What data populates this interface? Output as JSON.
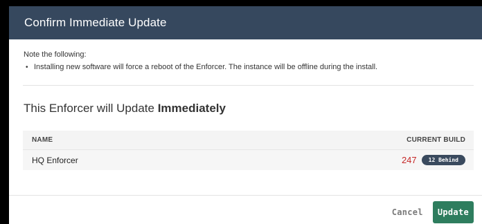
{
  "dialog": {
    "title": "Confirm Immediate Update",
    "note_label": "Note the following:",
    "notes": [
      "Installing new software will force a reboot of the Enforcer. The instance will be offline during the install."
    ],
    "heading_prefix": "This Enforcer will Update ",
    "heading_emphasis": "Immediately"
  },
  "table": {
    "headers": {
      "name": "NAME",
      "current_build": "CURRENT BUILD"
    },
    "rows": [
      {
        "name": "HQ Enforcer",
        "build": "247",
        "badge": "12 Behind"
      }
    ]
  },
  "footer": {
    "cancel_label": "Cancel",
    "update_label": "Update"
  },
  "colors": {
    "header_bg": "#36485e",
    "build_behind": "#c62828",
    "badge_bg": "#3a4a5e",
    "primary_button": "#2e7d5e"
  }
}
